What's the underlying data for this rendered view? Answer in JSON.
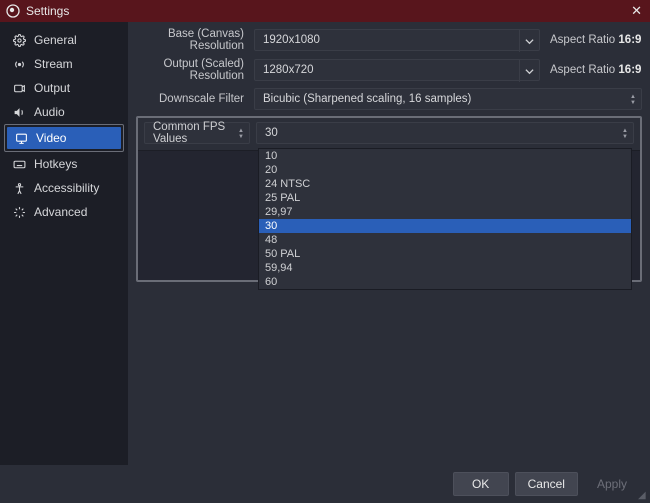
{
  "window": {
    "title": "Settings"
  },
  "sidebar": {
    "items": [
      {
        "label": "General"
      },
      {
        "label": "Stream"
      },
      {
        "label": "Output"
      },
      {
        "label": "Audio"
      },
      {
        "label": "Video"
      },
      {
        "label": "Hotkeys"
      },
      {
        "label": "Accessibility"
      },
      {
        "label": "Advanced"
      }
    ]
  },
  "content": {
    "base_label": "Base (Canvas) Resolution",
    "base_value": "1920x1080",
    "base_aspect_prefix": "Aspect Ratio ",
    "base_aspect_value": "16:9",
    "output_label": "Output (Scaled) Resolution",
    "output_value": "1280x720",
    "output_aspect_prefix": "Aspect Ratio ",
    "output_aspect_value": "16:9",
    "filter_label": "Downscale Filter",
    "filter_value": "Bicubic (Sharpened scaling, 16 samples)",
    "fps_label": "Common FPS Values",
    "fps_value": "30",
    "fps_options": [
      "10",
      "20",
      "24 NTSC",
      "25 PAL",
      "29,97",
      "30",
      "48",
      "50 PAL",
      "59,94",
      "60"
    ]
  },
  "footer": {
    "ok": "OK",
    "cancel": "Cancel",
    "apply": "Apply"
  }
}
